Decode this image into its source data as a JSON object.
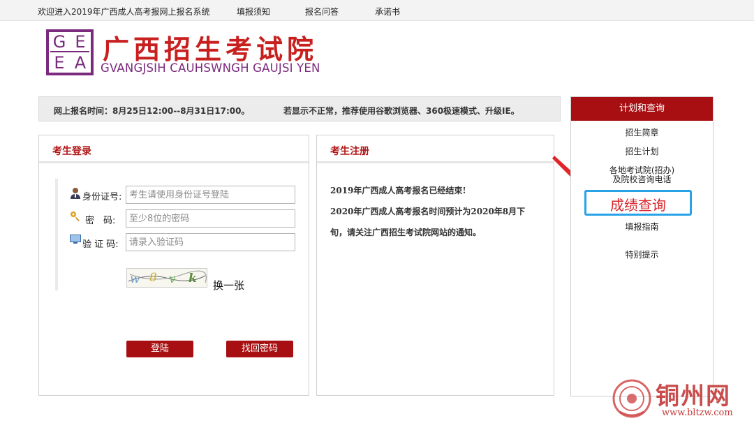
{
  "topbar": {
    "welcome": "欢迎进入2019年广西成人高考报网上报名系统",
    "nav": [
      "填报须知",
      "报名问答",
      "承诺书"
    ]
  },
  "logo": {
    "letters": [
      "G",
      "E",
      "E",
      "A"
    ],
    "title_cn": "广西招生考试院",
    "title_en": "GVANGJSIH CAUHSWNGH GAUJSI YEN"
  },
  "notice": {
    "time": "网上报名时间：8月25日12:00--8月31日17:00。",
    "browser_tip": "若显示不正常，推荐使用谷歌浏览器、360极速模式、升级IE。"
  },
  "login": {
    "title": "考生登录",
    "id_label": "身份证号:",
    "id_placeholder": "考生请使用身份证号登陆",
    "pwd_label": "密　码:",
    "pwd_placeholder": "至少8位的密码",
    "captcha_label": "验 证 码:",
    "captcha_placeholder": "请录入验证码",
    "captcha_text": "w8vk",
    "refresh_label": "换一张",
    "login_button": "登陆",
    "forgot_button": "找回密码"
  },
  "register": {
    "title": "考生注册",
    "lines": [
      "2019年广西成人高考报名已经结束!",
      "2020年广西成人高考报名时间预计为2020年8月下",
      "旬，请关注广西招生考试院网站的通知。"
    ]
  },
  "sidebar": {
    "title": "计划和查询",
    "items": [
      "招生简章",
      "招生计划",
      "各地考试院(招办)",
      "及院校咨询电话",
      "成绩查询",
      "填报指南",
      "特别提示"
    ]
  },
  "watermark": {
    "name": "铜州网",
    "url": "www.bltzw.com"
  },
  "colors": {
    "brand_red": "#a80f12",
    "logo_purple": "#7b2a7e",
    "highlight_blue": "#29a3e8",
    "arrow_red": "#e0262b"
  }
}
